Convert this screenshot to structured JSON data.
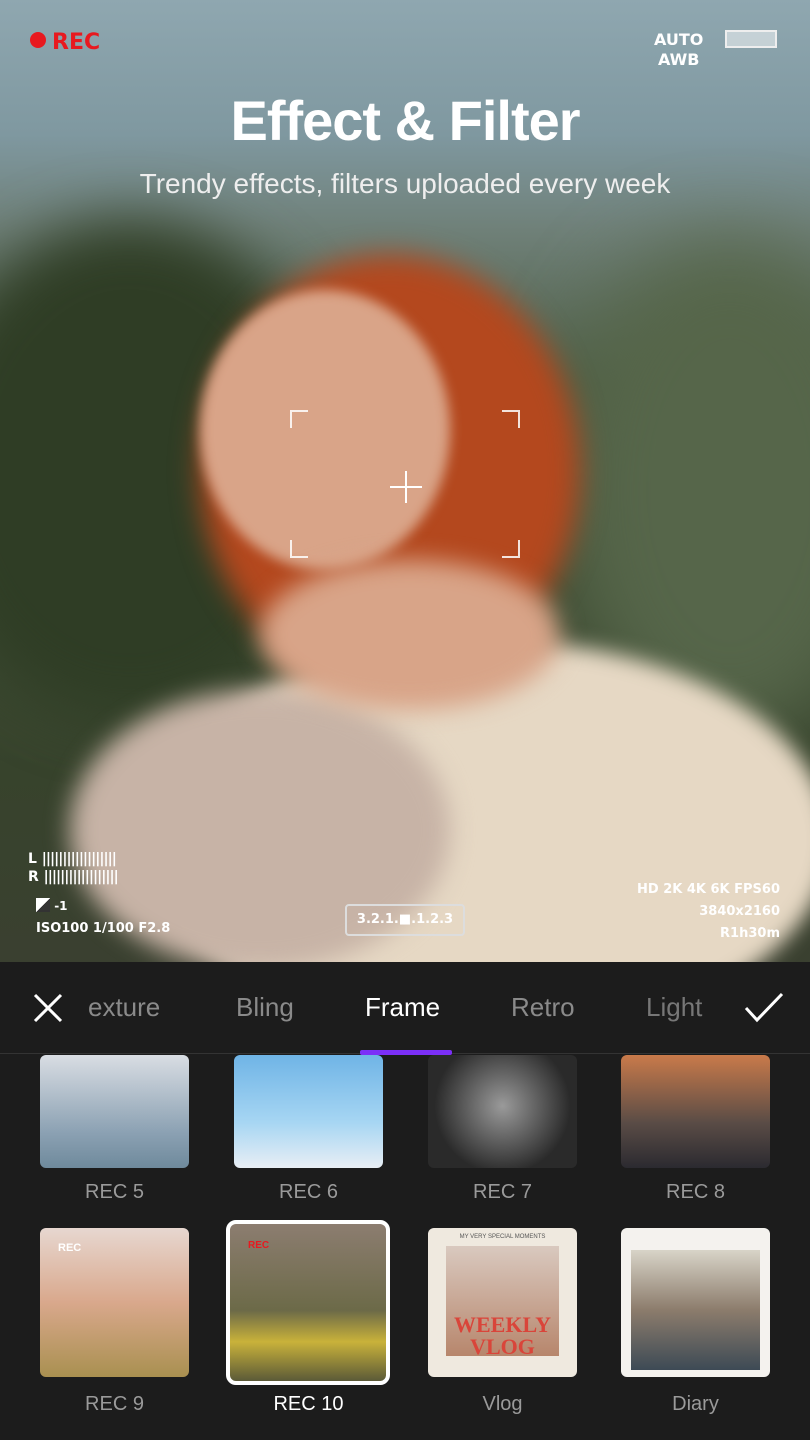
{
  "header": {
    "title": "Effect & Filter",
    "subtitle": "Trendy effects, filters uploaded every week"
  },
  "hud": {
    "rec": "REC",
    "auto": "AUTO",
    "awb": "AWB",
    "audio_l": "L",
    "audio_r": "R",
    "exposure": "-1",
    "iso": "ISO100 1/100 F2.8",
    "meter": "3.2.1.■.1.2.3",
    "resolutions": "HD 2K 4K 6K FPS60",
    "dimensions": "3840x2160",
    "remaining": "R1h30m",
    "rec_color": "#e8191f"
  },
  "toolbar": {
    "close_icon": "close-icon",
    "confirm_icon": "check-icon",
    "tabs": [
      {
        "label": "exture"
      },
      {
        "label": "Bling"
      },
      {
        "label": "Frame",
        "active": true
      },
      {
        "label": "Retro"
      },
      {
        "label": "Light"
      }
    ],
    "accent": "#7b2ff7"
  },
  "frames": [
    {
      "label": "REC 5"
    },
    {
      "label": "REC 6"
    },
    {
      "label": "REC 7"
    },
    {
      "label": "REC 8"
    },
    {
      "label": "REC 9",
      "inner": "REC"
    },
    {
      "label": "REC 10",
      "selected": true,
      "inner": "REC"
    },
    {
      "label": "Vlog",
      "inner": "MY VERY SPECIAL MOMENTS",
      "inner2": "WEEKLY VLOG"
    },
    {
      "label": "Diary"
    }
  ]
}
